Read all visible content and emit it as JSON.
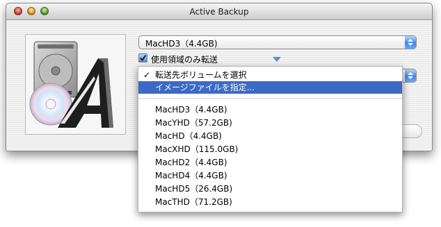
{
  "window": {
    "title": "Active Backup"
  },
  "source_popup": {
    "value": "MacHD3（4.4GB)"
  },
  "used_area_checkbox": {
    "label": "使用領域のみ転送",
    "checked": true
  },
  "dest_popup": {
    "value": ""
  },
  "menu": {
    "header_items": [
      {
        "label": "転送先ボリュームを選択",
        "checked": true,
        "selected": false
      },
      {
        "label": "イメージファイルを指定...",
        "checked": false,
        "selected": true
      }
    ],
    "volumes": [
      "MacHD3（4.4GB)",
      "MacYHD（57.2GB)",
      "MacHD（4.4GB)",
      "MacXHD（115.0GB)",
      "MacHD2（4.4GB)",
      "MacHD4（4.4GB)",
      "MacHD5（26.4GB)",
      "MacTHD（71.2GB)"
    ]
  },
  "icons": {
    "app_icon": "hard-drive-cd-a-icon",
    "check": "checkmark-icon",
    "popup_arrows": "up-down-arrows-icon",
    "disclosure": "disclosure-triangle-icon"
  },
  "colors": {
    "highlight": "#3b69c4",
    "accent": "#3f86ee"
  }
}
